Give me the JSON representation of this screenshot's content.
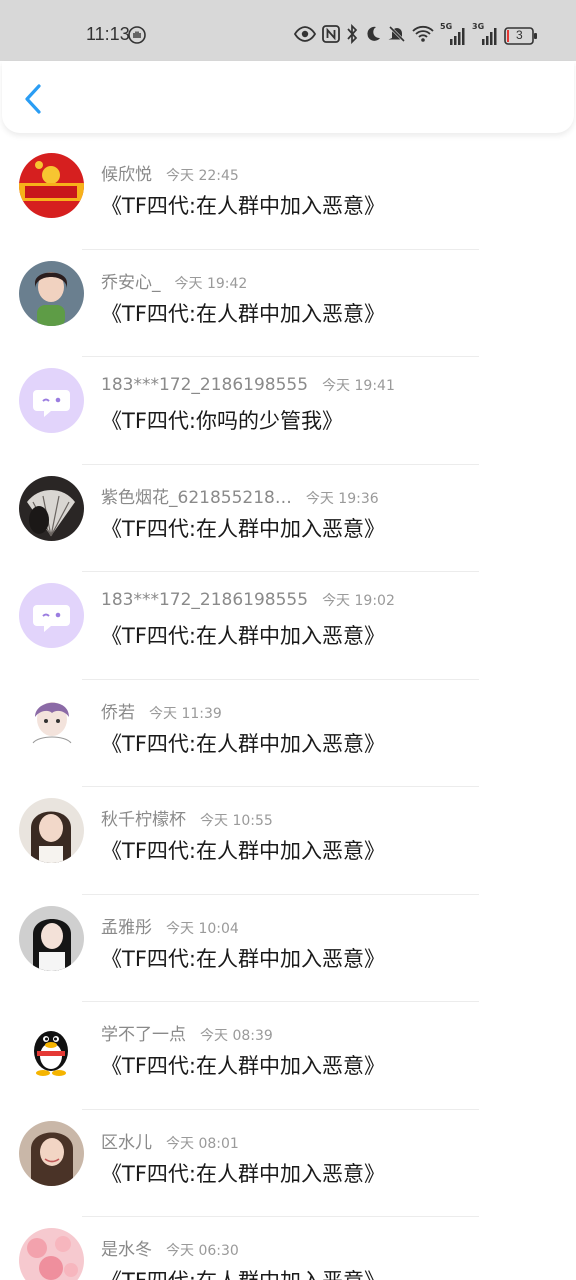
{
  "status_bar": {
    "time": "11:13",
    "signal_5g": "5G",
    "signal_3g": "3G",
    "battery": "3"
  },
  "nav": {
    "back_icon": "chevron-left-icon"
  },
  "messages": [
    {
      "nickname": "候欣悦",
      "time": "今天 22:45",
      "text": "《TF四代:在人群中加入恶意》",
      "avatar": "red-banner"
    },
    {
      "nickname": "乔安心_",
      "time": "今天 19:42",
      "text": "《TF四代:在人群中加入恶意》",
      "avatar": "girl-photo"
    },
    {
      "nickname": "183***172_2186198555",
      "time": "今天 19:41",
      "text": "《TF四代:你吗的少管我》",
      "avatar": "default-chat"
    },
    {
      "nickname": "紫色烟花_621855218…",
      "time": "今天 19:36",
      "text": "《TF四代:在人群中加入恶意》",
      "avatar": "fan-photo"
    },
    {
      "nickname": "183***172_2186198555",
      "time": "今天 19:02",
      "text": "《TF四代:在人群中加入恶意》",
      "avatar": "default-chat"
    },
    {
      "nickname": "侨若",
      "time": "今天 11:39",
      "text": "《TF四代:在人群中加入恶意》",
      "avatar": "sketch-boy"
    },
    {
      "nickname": "秋千柠檬杯",
      "time": "今天 10:55",
      "text": "《TF四代:在人群中加入恶意》",
      "avatar": "girl-photo"
    },
    {
      "nickname": "孟雅彤",
      "time": "今天 10:04",
      "text": "《TF四代:在人群中加入恶意》",
      "avatar": "girl-photo"
    },
    {
      "nickname": "学不了一点",
      "time": "今天 08:39",
      "text": "《TF四代:在人群中加入恶意》",
      "avatar": "penguin"
    },
    {
      "nickname": "区水儿",
      "time": "今天 08:01",
      "text": "《TF四代:在人群中加入恶意》",
      "avatar": "girl-photo"
    },
    {
      "nickname": "是水冬",
      "time": "今天 06:30",
      "text": "《TF四代:在人群中加入恶意》",
      "avatar": "pink-bokeh"
    }
  ]
}
